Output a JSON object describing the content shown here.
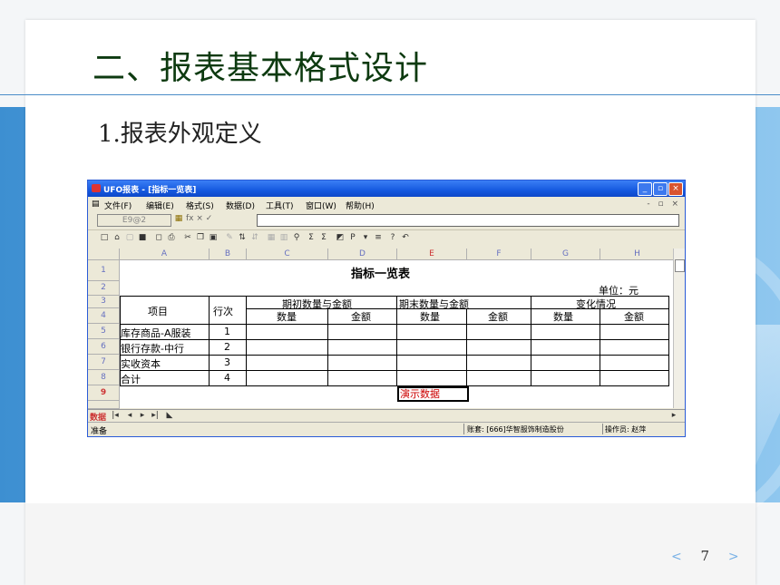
{
  "slide": {
    "title": "二、报表基本格式设计",
    "subtitle": "1.报表外观定义",
    "page_number": "7",
    "prev_glyph": "<",
    "next_glyph": ">"
  },
  "window": {
    "title": "UFO报表 - [指标一览表]",
    "menu": [
      "文件(F)",
      "编辑(E)",
      "格式(S)",
      "数据(D)",
      "工具(T)",
      "窗口(W)",
      "帮助(H)"
    ],
    "mdi_controls": "- ▫ ×",
    "cell_ref": "E9@2",
    "fx_glyphs": "fx × ✓",
    "formula_value": ""
  },
  "sheet": {
    "columns": [
      "A",
      "B",
      "C",
      "D",
      "E",
      "F",
      "G",
      "H"
    ],
    "active_column": "E",
    "rows": [
      "1",
      "2",
      "3",
      "4",
      "5",
      "6",
      "7",
      "8",
      "9"
    ],
    "active_row": "9",
    "report_title": "指标一览表",
    "unit": "单位：元",
    "header": {
      "item": "项目",
      "line_no": "行次",
      "opening": "期初数量与金额",
      "closing": "期末数量与金额",
      "change": "变化情况",
      "qty": "数量",
      "amount": "金额"
    },
    "items": [
      {
        "name": "库存商品-A服装",
        "no": "1"
      },
      {
        "name": "银行存款-中行",
        "no": "2"
      },
      {
        "name": "实收资本",
        "no": "3"
      },
      {
        "name": "合计",
        "no": "4"
      }
    ],
    "demo_cell": "演示数据"
  },
  "statusbar": {
    "sheet_tab": "数据",
    "ready": "准备",
    "account": "账套: [666]华智服饰制造股份",
    "operator": "操作员: 赵萍"
  },
  "colors": {
    "title_green": "#0d3a10",
    "band_blue": "#4a96d8",
    "xp_title_blue": "#1559e0",
    "demo_red": "#cc0000"
  }
}
